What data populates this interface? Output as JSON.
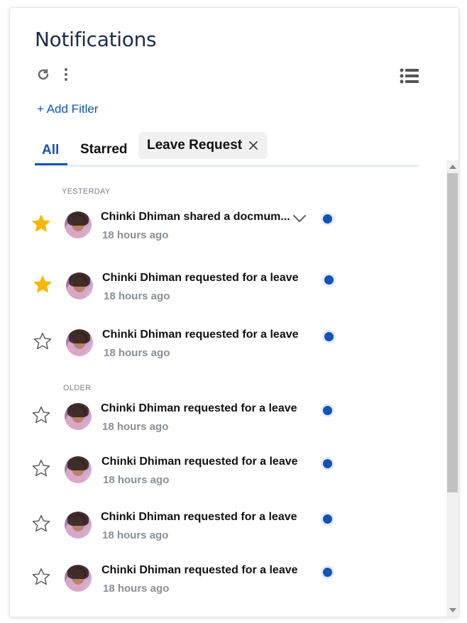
{
  "header": {
    "title": "Notifications"
  },
  "toolbar": {
    "refresh_icon": "refresh-icon",
    "more_icon": "more-vertical-icon",
    "list_icon": "list-view-icon"
  },
  "filter": {
    "add_label": "+ Add Fitler"
  },
  "tabs": [
    {
      "label": "All",
      "active": true
    },
    {
      "label": "Starred",
      "active": false
    }
  ],
  "chip": {
    "label": "Leave Request"
  },
  "sections": {
    "yesterday": "YESTERDAY",
    "older": "OLDER"
  },
  "notifications": [
    {
      "message": "Chinki Dhiman shared a docmum...",
      "time": "18 hours ago",
      "starred": true,
      "unread": true,
      "expandable": true
    },
    {
      "message": "Chinki Dhiman requested for a leave",
      "time": "18 hours ago",
      "starred": true,
      "unread": true
    },
    {
      "message": "Chinki Dhiman requested for a leave",
      "time": "18 hours ago",
      "starred": false,
      "unread": true
    },
    {
      "message": "Chinki Dhiman requested for a leave",
      "time": "18 hours ago",
      "starred": false,
      "unread": true
    },
    {
      "message": "Chinki Dhiman requested for a leave",
      "time": "18 hours ago",
      "starred": false,
      "unread": true
    },
    {
      "message": "Chinki Dhiman requested for a leave",
      "time": "18 hours ago",
      "starred": false,
      "unread": true
    },
    {
      "message": "Chinki Dhiman requested for a leave",
      "time": "18 hours ago",
      "starred": false,
      "unread": true
    }
  ],
  "colors": {
    "accent": "#1452b8",
    "star_filled": "#f5b800",
    "title": "#1d2b4f"
  }
}
